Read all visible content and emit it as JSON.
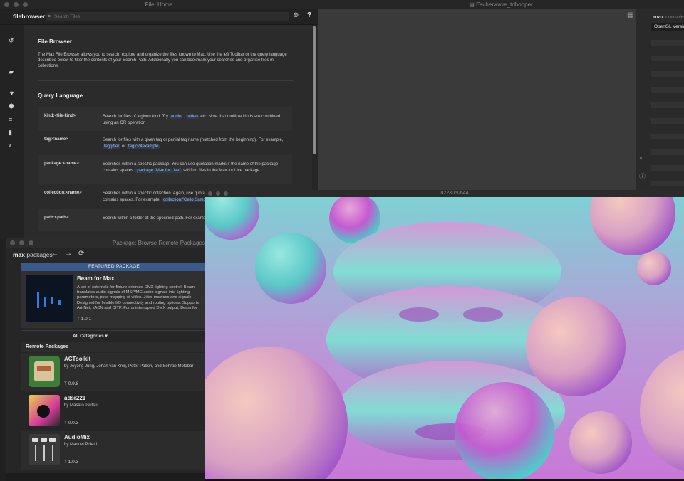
{
  "file_window": {
    "title": "File: Home",
    "brand": "filebrowser",
    "search_placeholder": "Search Files",
    "help": "?",
    "heading": "File Browser",
    "intro": "The Max File Browser allows you to search, explore and organize the files known to Max. Use the left Toolbar or the query language described below to filter the contents of your Search Path. Additionally you can bookmark your searches and organise files in collections.",
    "query_heading": "Query Language",
    "rows": [
      {
        "key": "kind:<file-kind>",
        "pre": "Search for files of a given kind. Try ",
        "t1": "audio",
        "mid": " , ",
        "t2": "video",
        "post": " etc. Note that multiple kinds are combined using an OR operation"
      },
      {
        "key": "tag:<name>",
        "pre": "Search for files with a given tag or partial tag name (matched from the beginning). For example, ",
        "t1": "tag:jitter",
        "mid": " or ",
        "t2": "tag:c74example",
        "post": ""
      },
      {
        "key": "package:<name>",
        "pre": "Searches within a specific package. You can use quotation marks if the name of the package contains spaces. ",
        "t1": "package:\"Max for Live\"",
        "mid": " will find files in the Max for Live package.",
        "t2": "",
        "post": ""
      },
      {
        "key": "collection:<name>",
        "pre": "Searches within a specific collection. Again, use quotation marks if the name of the collection contains spaces. For example, ",
        "t1": "collection:\"Cello Samples\"",
        "mid": "",
        "t2": "",
        "post": ""
      },
      {
        "key": "path:<path>",
        "pre": "Search within a folder at the specified path. For example",
        "t1": "",
        "mid": "",
        "t2": "",
        "post": ""
      }
    ]
  },
  "patcher": {
    "title": "Escherwave_tdhooper",
    "console_label_max": "max",
    "console_label": "console",
    "console_line": "OpenGL Version"
  },
  "package_window": {
    "title": "Package: Browse Remote Packages",
    "brand_max": "max",
    "brand_packages": "packages",
    "featured_label": "FEATURED PACKAGE",
    "featured": {
      "name": "Beam for Max",
      "desc": "A set of externals for fixture-oriented DMX lighting control. Beam translates audio signals of MSP/MC audio signals into lighting parameters, pixel mapping of video. Jitter matrices and signals. Designed for flexible I/O connectivity and routing options. Supports Art-Net, sACN and CITP. For uninterrupted DMX output, Beam for Max needs to be licensed. Trial mode lets you experiment. beam.showsync.com/beam-for-max",
      "version": "1.0.1"
    },
    "categories": "All Categories",
    "remote_heading": "Remote Packages",
    "packages": [
      {
        "name": "ACToolkit",
        "authors": "by Jeyong Jung, Johan van Kreij, Peter Pabon, and Sohrab Motabar",
        "version": "0.9.8"
      },
      {
        "name": "adsr221",
        "authors": "by Masato Tsutsui",
        "version": "0.0.3"
      },
      {
        "name": "AudioMix",
        "authors": "by Manuel Poletti",
        "version": "1.0.3"
      }
    ]
  },
  "render_window": {
    "title": "u223050644"
  },
  "colors": {
    "accent": "#3a5a8c",
    "tag_text": "#8fb7ff",
    "scene_pink": "#c86bd6",
    "scene_cyan": "#3fd6c8"
  }
}
